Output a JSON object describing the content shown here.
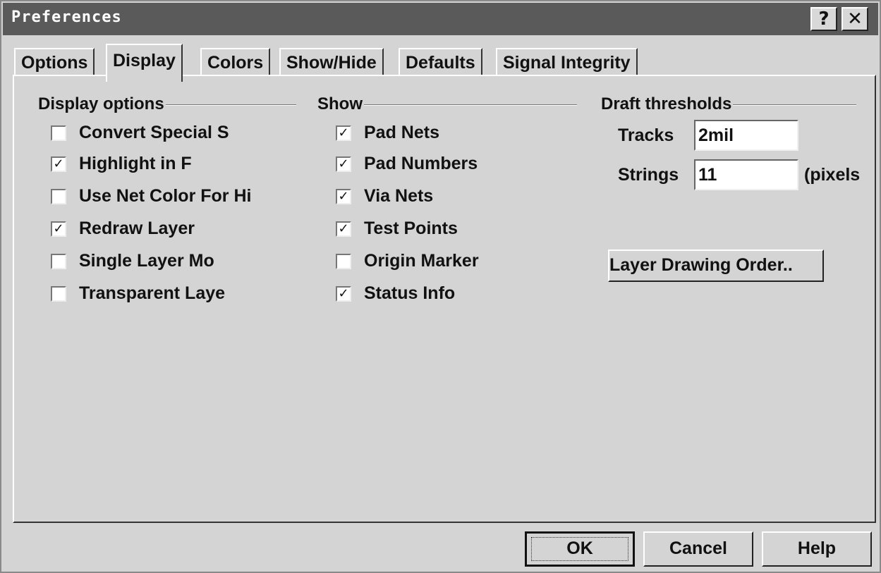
{
  "window": {
    "title": "Preferences",
    "help_glyph": "?",
    "close_glyph": "✕"
  },
  "tabs": [
    {
      "label": "Options"
    },
    {
      "label": "Display"
    },
    {
      "label": "Colors"
    },
    {
      "label": "Show/Hide"
    },
    {
      "label": "Defaults"
    },
    {
      "label": "Signal Integrity"
    }
  ],
  "active_tab": "Display",
  "display_options": {
    "title": "Display options",
    "items": [
      {
        "label": "Convert Special S",
        "checked": false
      },
      {
        "label": "Highlight in F",
        "checked": true
      },
      {
        "label": "Use Net Color For Hi",
        "checked": false
      },
      {
        "label": "Redraw Layer",
        "checked": true
      },
      {
        "label": "Single Layer Mo",
        "checked": false
      },
      {
        "label": "Transparent Laye",
        "checked": false
      }
    ]
  },
  "show": {
    "title": "Show",
    "items": [
      {
        "label": "Pad Nets",
        "checked": true
      },
      {
        "label": "Pad Numbers",
        "checked": true
      },
      {
        "label": "Via Nets",
        "checked": true
      },
      {
        "label": "Test Points",
        "checked": true
      },
      {
        "label": "Origin Marker",
        "checked": false
      },
      {
        "label": "Status Info",
        "checked": true
      }
    ]
  },
  "draft_thresholds": {
    "title": "Draft thresholds",
    "tracks_label": "Tracks",
    "tracks_value": "2mil",
    "strings_label": "Strings",
    "strings_value": "11",
    "strings_unit": "(pixels"
  },
  "layer_order_button": "Layer Drawing Order..",
  "footer": {
    "ok": "OK",
    "cancel": "Cancel",
    "help": "Help"
  },
  "check_glyph": "✓"
}
